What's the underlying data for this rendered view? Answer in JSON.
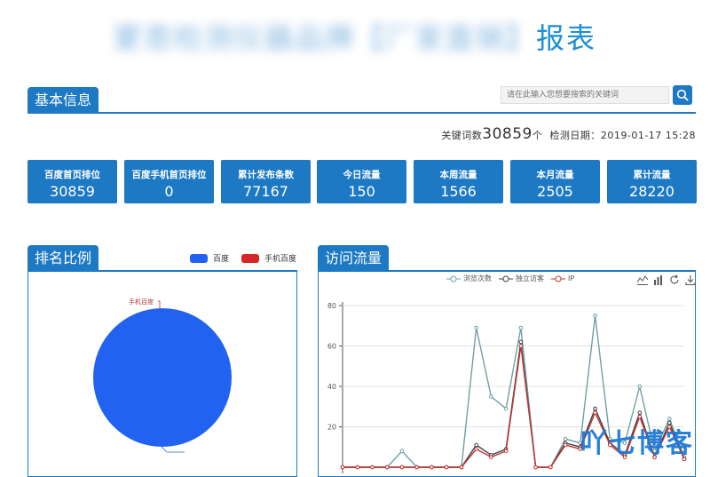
{
  "title": {
    "blurred": "蒙恩检测仪器品牌【厂家直销】",
    "suffix": "报表"
  },
  "basic": {
    "tab": "基本信息",
    "search_placeholder": "请在此输入您想要搜索的关键词"
  },
  "meta": {
    "kw_label": "关键词数",
    "kw_count": "30859",
    "kw_unit": "个",
    "date_label": "检测日期：",
    "date": "2019-01-17 15:28"
  },
  "stats": [
    {
      "label": "百度首页排位",
      "value": "30859"
    },
    {
      "label": "百度手机首页排位",
      "value": "0"
    },
    {
      "label": "累计发布条数",
      "value": "77167"
    },
    {
      "label": "今日流量",
      "value": "150"
    },
    {
      "label": "本周流量",
      "value": "1566"
    },
    {
      "label": "本月流量",
      "value": "2505"
    },
    {
      "label": "累计流量",
      "value": "28220"
    }
  ],
  "ranking": {
    "tab": "排名比例",
    "legend": [
      {
        "name": "百度",
        "color": "#2163f0"
      },
      {
        "name": "手机百度",
        "color": "#d62728"
      }
    ],
    "slice_label": "手机百度"
  },
  "traffic": {
    "tab": "访问流量",
    "tools": [
      "line-chart-icon",
      "bar-chart-icon",
      "refresh-icon",
      "download-icon"
    ]
  },
  "chart_data": {
    "type": "line",
    "ylim": [
      0,
      80
    ],
    "yticks": [
      20,
      40,
      60,
      80
    ],
    "grid": true,
    "legend_position": "top",
    "series": [
      {
        "name": "浏览次数",
        "color": "#6ea0a4",
        "values": [
          0,
          0,
          0,
          0,
          8,
          0,
          0,
          0,
          0,
          69,
          35,
          29,
          69,
          0,
          0,
          14,
          12,
          75,
          14,
          12,
          40,
          8,
          24,
          5
        ]
      },
      {
        "name": "独立访客",
        "color": "#3a3f4a",
        "values": [
          0,
          0,
          0,
          0,
          0,
          0,
          0,
          0,
          0,
          11,
          6,
          9,
          62,
          0,
          0,
          12,
          10,
          29,
          12,
          6,
          27,
          5,
          22,
          4
        ]
      },
      {
        "name": "IP",
        "color": "#c23531",
        "values": [
          0,
          0,
          0,
          0,
          0,
          0,
          0,
          0,
          0,
          9,
          5,
          8,
          60,
          0,
          0,
          11,
          9,
          27,
          11,
          5,
          25,
          5,
          20,
          4
        ]
      }
    ]
  },
  "watermark": "吖七博客"
}
